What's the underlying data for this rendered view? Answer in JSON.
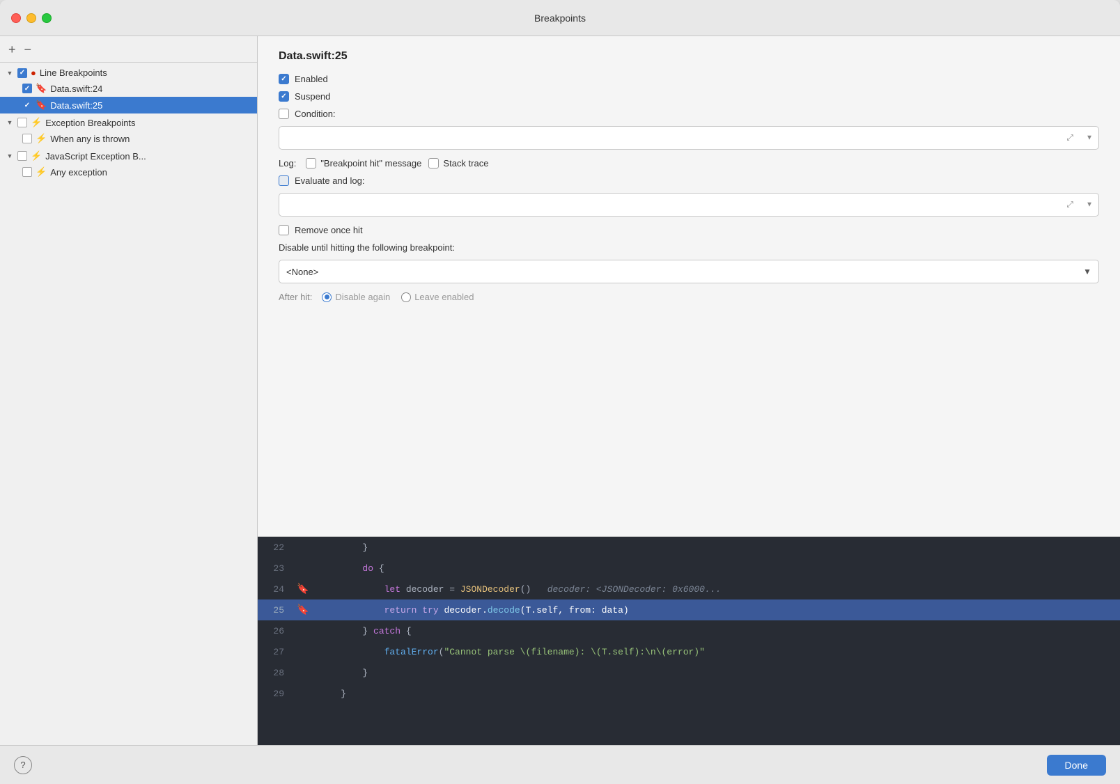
{
  "window": {
    "title": "Breakpoints"
  },
  "left_panel": {
    "add_label": "+",
    "remove_label": "−",
    "groups": [
      {
        "id": "line-breakpoints",
        "label": "Line Breakpoints",
        "checked": true,
        "expanded": true,
        "items": [
          {
            "id": "data-swift-24",
            "label": "Data.swift:24",
            "checked": true,
            "selected": false
          },
          {
            "id": "data-swift-25",
            "label": "Data.swift:25",
            "checked": true,
            "selected": true
          }
        ]
      },
      {
        "id": "exception-breakpoints",
        "label": "Exception Breakpoints",
        "checked": false,
        "expanded": true,
        "items": [
          {
            "id": "when-any-thrown",
            "label": "When any is thrown",
            "checked": false,
            "selected": false
          }
        ]
      },
      {
        "id": "js-exception-breakpoints",
        "label": "JavaScript Exception B...",
        "checked": false,
        "expanded": false,
        "items": [
          {
            "id": "any-exception",
            "label": "Any exception",
            "checked": false,
            "selected": false
          }
        ]
      }
    ]
  },
  "right_panel": {
    "title": "Data.swift:25",
    "enabled_label": "Enabled",
    "enabled_checked": true,
    "suspend_label": "Suspend",
    "suspend_checked": true,
    "condition_label": "Condition:",
    "condition_checked": false,
    "condition_value": "",
    "condition_placeholder": "",
    "log_label": "Log:",
    "log_breakpoint_hit_label": "\"Breakpoint hit\" message",
    "log_breakpoint_hit_checked": false,
    "log_stack_trace_label": "Stack trace",
    "log_stack_trace_checked": false,
    "evaluate_log_label": "Evaluate and log:",
    "evaluate_log_checked": false,
    "evaluate_log_value": "",
    "remove_once_hit_label": "Remove once hit",
    "remove_once_hit_checked": false,
    "disable_until_label": "Disable until hitting the following breakpoint:",
    "disable_until_value": "<None>",
    "after_hit_label": "After hit:",
    "disable_again_label": "Disable again",
    "disable_again_selected": true,
    "leave_enabled_label": "Leave enabled",
    "leave_enabled_selected": false
  },
  "code": {
    "lines": [
      {
        "num": "22",
        "content": "        }",
        "active": false,
        "has_bp": false
      },
      {
        "num": "23",
        "content": "        do {",
        "active": false,
        "has_bp": false
      },
      {
        "num": "24",
        "content": "            let decoder = JSONDecoder()",
        "active": false,
        "has_bp": true,
        "comment": "   decoder: <JSONDecoder: 0x600..."
      },
      {
        "num": "25",
        "content": "            return try decoder.decode(T.self, from: data)",
        "active": true,
        "has_bp": true
      },
      {
        "num": "26",
        "content": "        } catch {",
        "active": false,
        "has_bp": false
      },
      {
        "num": "27",
        "content": "            fatalError(\"Cannot parse \\(filename): \\(T.self):\\n\\(error)",
        "active": false,
        "has_bp": false
      },
      {
        "num": "28",
        "content": "        }",
        "active": false,
        "has_bp": false
      },
      {
        "num": "29",
        "content": "    }",
        "active": false,
        "has_bp": false
      }
    ]
  },
  "footer": {
    "help_label": "?",
    "done_label": "Done"
  }
}
